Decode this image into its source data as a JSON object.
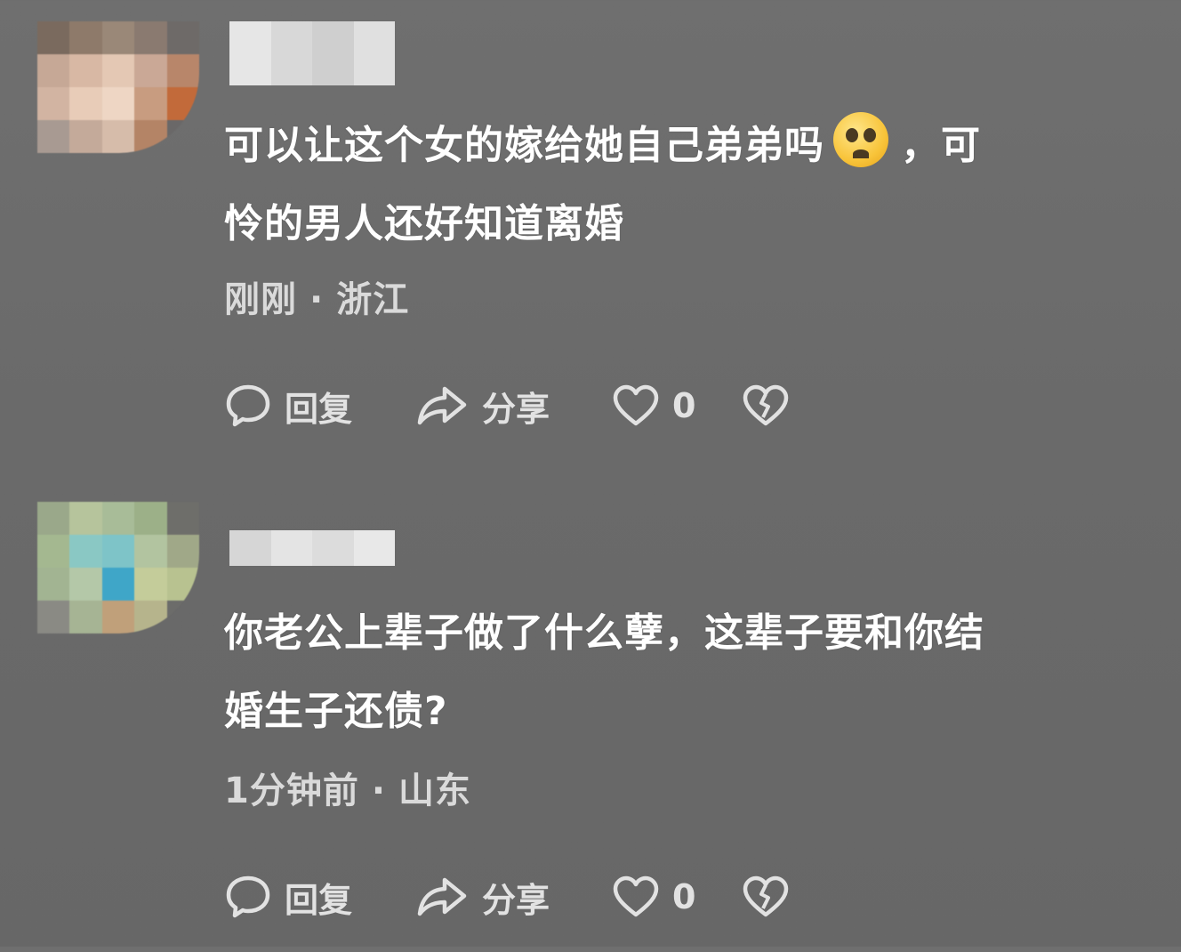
{
  "comments": [
    {
      "avatar_colors": [
        "#7a6a5e",
        "#8e7a6a",
        "#9a8878",
        "#8a7a70",
        "#6e6a68",
        "#c6a896",
        "#d8b8a4",
        "#e4c8b4",
        "#caa896",
        "#b8866a",
        "#d2b4a2",
        "#e8ccb8",
        "#eed6c4",
        "#c89c80",
        "#c26a3a",
        "#a89a92",
        "#c4aa9a",
        "#d6bcaa",
        "#b48466",
        "#6a6868"
      ],
      "username_colors": [
        "#e6e6e6",
        "#d8d8d8",
        "#cfcfcf",
        "#e0e0e0"
      ],
      "text_before_emoji": "可以让这个女的嫁给她自己弟弟吗",
      "text_after_emoji": "，可",
      "text_line2": "怜的男人还好知道离婚",
      "time": "刚刚",
      "separator": "·",
      "location": "浙江",
      "reply_label": "回复",
      "share_label": "分享",
      "like_count": "0"
    },
    {
      "avatar_colors": [
        "#9aa88a",
        "#b6c49c",
        "#a8bc98",
        "#9cb088",
        "#6e6e6a",
        "#a4b890",
        "#8ac8c4",
        "#7ec4c8",
        "#b2c4a0",
        "#a0a888",
        "#a2b492",
        "#b4c8a8",
        "#3fa6c8",
        "#c4cc9a",
        "#b8c290",
        "#8a8a84",
        "#a6b494",
        "#c0a07a",
        "#b6b48c",
        "#6c6c6a"
      ],
      "username_colors": [
        "#d6d6d6",
        "#e4e4e4",
        "#dcdcdc",
        "#e8e8e8"
      ],
      "text_line1": "你老公上辈子做了什么孽，这辈子要和你结",
      "text_line2": "婚生子还债?",
      "time": "1分钟前",
      "separator": "·",
      "location": "山东",
      "reply_label": "回复",
      "share_label": "分享",
      "like_count": "0"
    }
  ],
  "icons": {
    "reply": "speech-bubble-icon",
    "share": "share-arrow-icon",
    "like": "heart-outline-icon",
    "dislike": "broken-heart-icon"
  }
}
